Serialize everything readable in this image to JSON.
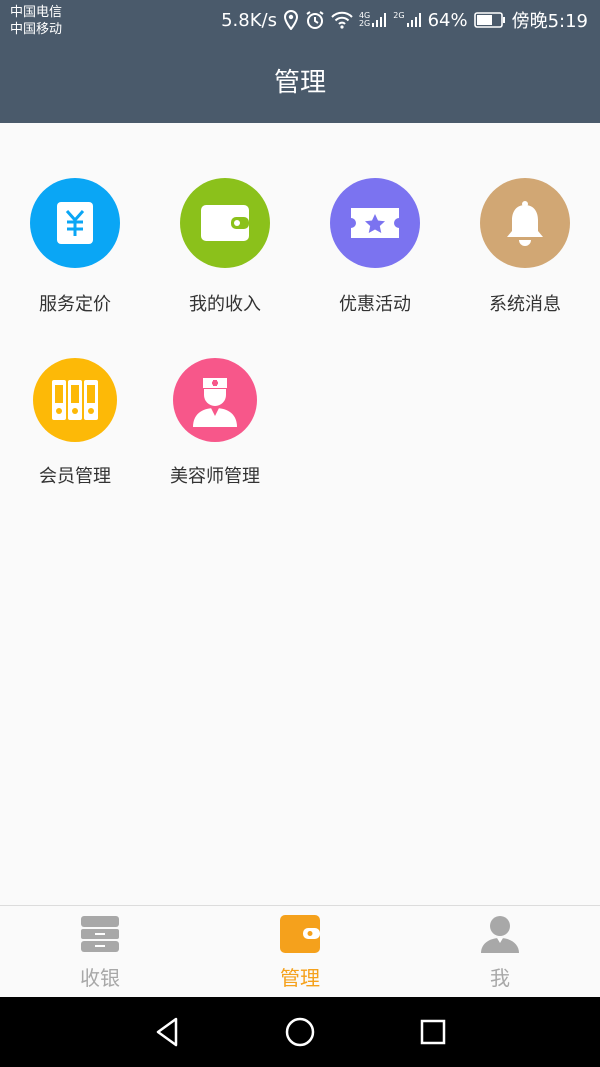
{
  "status_bar": {
    "carrier_1": "中国电信",
    "carrier_2": "中国移动",
    "speed": "5.8K/s",
    "net_tag_1_top": "4G",
    "net_tag_1_bottom": "2G",
    "net_tag_2": "2G",
    "battery": "64%",
    "time": "傍晚5:19"
  },
  "header": {
    "title": "管理"
  },
  "menu": [
    {
      "label": "服务定价",
      "icon": "price-tag-icon",
      "color": "#0aa6f5"
    },
    {
      "label": "我的收入",
      "icon": "wallet-icon",
      "color": "#8bc11b"
    },
    {
      "label": "优惠活动",
      "icon": "ticket-icon",
      "color": "#7b73f0"
    },
    {
      "label": "系统消息",
      "icon": "bell-icon",
      "color": "#d1a774"
    },
    {
      "label": "会员管理",
      "icon": "binders-icon",
      "color": "#fdb907"
    },
    {
      "label": "美容师管理",
      "icon": "nurse-icon",
      "color": "#f7578a"
    }
  ],
  "tabs": [
    {
      "label": "收银",
      "icon": "cash-register-icon",
      "active": false
    },
    {
      "label": "管理",
      "icon": "wallet-icon",
      "active": true
    },
    {
      "label": "我",
      "icon": "user-icon",
      "active": false
    }
  ],
  "colors": {
    "header_bg": "#4a5a6b",
    "tab_active": "#f5a11c",
    "tab_inactive": "#a8a8a8"
  }
}
